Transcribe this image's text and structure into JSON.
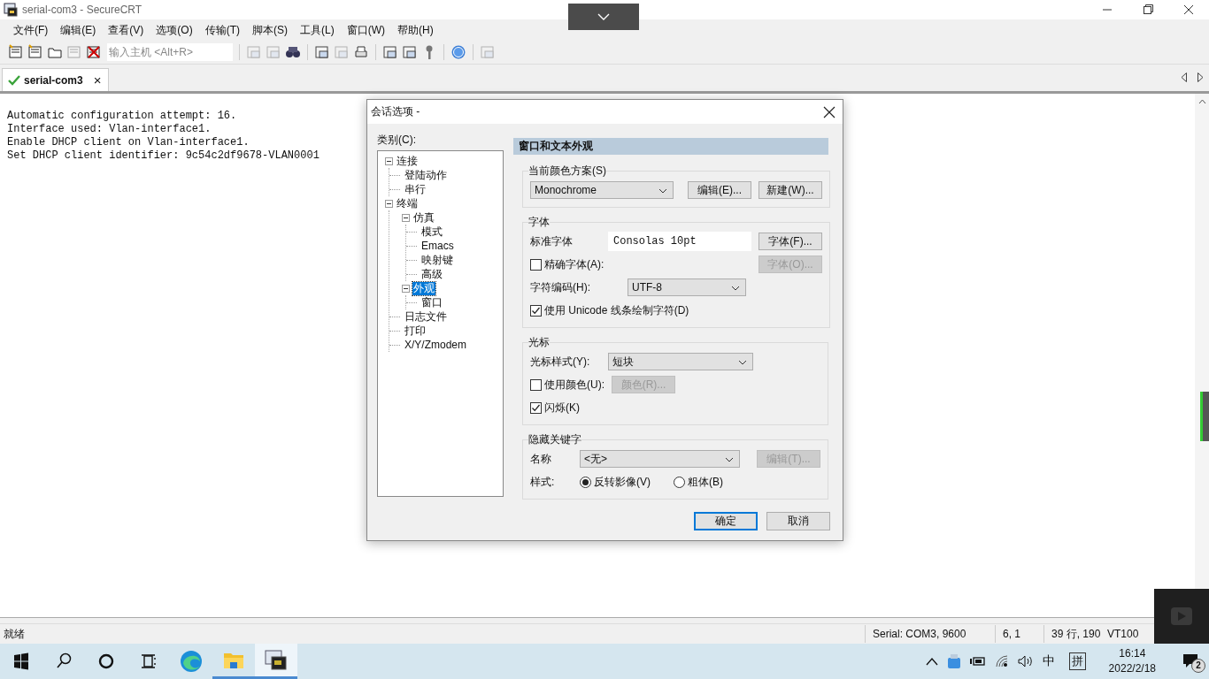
{
  "window": {
    "title": "serial-com3 - SecureCRT"
  },
  "menu": [
    "文件(F)",
    "编辑(E)",
    "查看(V)",
    "选项(O)",
    "传输(T)",
    "脚本(S)",
    "工具(L)",
    "窗口(W)",
    "帮助(H)"
  ],
  "toolbar": {
    "host_field": {
      "placeholder": "输入主机 <Alt+R>"
    },
    "before": [
      {
        "disabled": false
      },
      {
        "disabled": false
      },
      {
        "disabled": false
      },
      {
        "disabled": true
      },
      {
        "disabled": false
      }
    ],
    "after": [
      {
        "disabled": true
      },
      {
        "disabled": true
      },
      {
        "disabled": false
      },
      {
        "disabled": false
      },
      {
        "disabled": true
      },
      {
        "disabled": false
      },
      {
        "disabled": false
      },
      {
        "disabled": false
      },
      {
        "disabled": false
      },
      {
        "disabled": false
      },
      {
        "disabled": true
      }
    ]
  },
  "tabs": [
    {
      "label": "serial-com3",
      "selected": true,
      "connected": true,
      "close": "×"
    }
  ],
  "terminal": {
    "lines": [
      "Automatic configuration attempt: 16.",
      "Interface used: Vlan-interface1.",
      "Enable DHCP client on Vlan-interface1.",
      "Set DHCP client identifier: 9c54c2df9678-VLAN0001"
    ]
  },
  "dialog": {
    "title": "会话选项 -",
    "category_label": "类别(C):",
    "tree": [
      {
        "label": "连接",
        "selected": false,
        "expanded": true,
        "children": [
          {
            "label": "登陆动作",
            "selected": false
          },
          {
            "label": "串行",
            "selected": false
          }
        ]
      },
      {
        "label": "终端",
        "selected": false,
        "expanded": true,
        "children": [
          {
            "label": "仿真",
            "selected": false,
            "expanded": true,
            "children": [
              {
                "label": "模式",
                "selected": false
              },
              {
                "label": "Emacs",
                "selected": false
              },
              {
                "label": "映射键",
                "selected": false
              },
              {
                "label": "高级",
                "selected": false
              }
            ]
          },
          {
            "label": "外观",
            "selected": true,
            "expanded": true,
            "children": [
              {
                "label": "窗口",
                "selected": false
              }
            ]
          },
          {
            "label": "日志文件",
            "selected": false
          },
          {
            "label": "打印",
            "selected": false
          },
          {
            "label": "X/Y/Zmodem",
            "selected": false
          }
        ]
      }
    ],
    "header": "窗口和文本外观",
    "color_scheme": {
      "legend": "当前颜色方案(S)",
      "value": "Monochrome",
      "buttons": [
        {
          "label": "编辑(E)...",
          "disabled": false
        },
        {
          "label": "新建(W)...",
          "disabled": false
        }
      ]
    },
    "font": {
      "legend": "字体",
      "standard_label": "标准字体",
      "standard_value": "Consolas 10pt",
      "standard_button": {
        "label": "字体(F)...",
        "disabled": false
      },
      "precise": {
        "label": "精确字体(A):",
        "checked": false
      },
      "precise_button": {
        "label": "字体(O)...",
        "disabled": true
      },
      "encoding_label": "字符编码(H):",
      "encoding_value": "UTF-8",
      "unicode": {
        "label": "使用 Unicode 线条绘制字符(D)",
        "checked": true
      }
    },
    "cursor": {
      "legend": "光标",
      "style_label": "光标样式(Y):",
      "style_value": "短块",
      "use_color": {
        "label": "使用颜色(U):",
        "checked": false
      },
      "color_button": {
        "label": "颜色(R)...",
        "disabled": true
      },
      "blink": {
        "label": "闪烁(K)",
        "checked": true
      }
    },
    "keywords": {
      "legend": "隐藏关键字",
      "name_label": "名称",
      "name_value": "<无>",
      "edit_button": {
        "label": "编辑(T)...",
        "disabled": true
      },
      "style_label": "样式:",
      "styles": [
        {
          "label": "反转影像(V)",
          "selected": true
        },
        {
          "label": "粗体(B)",
          "selected": false
        }
      ]
    },
    "buttons": [
      {
        "label": "确定",
        "default": true
      },
      {
        "label": "取消",
        "default": false
      }
    ]
  },
  "status_bar": {
    "message": "就绪",
    "cells": [
      "Serial: COM3, 9600",
      "6,   1",
      "39 行, 190",
      "VT100"
    ]
  },
  "taskbar": {
    "apps": [
      {
        "selected": false,
        "running": false
      },
      {
        "selected": false,
        "running": true
      },
      {
        "selected": true,
        "running": true
      }
    ],
    "ime": [
      "中",
      "拼"
    ],
    "time": "16:14",
    "date": "2022/2/18",
    "notifications": "2"
  }
}
